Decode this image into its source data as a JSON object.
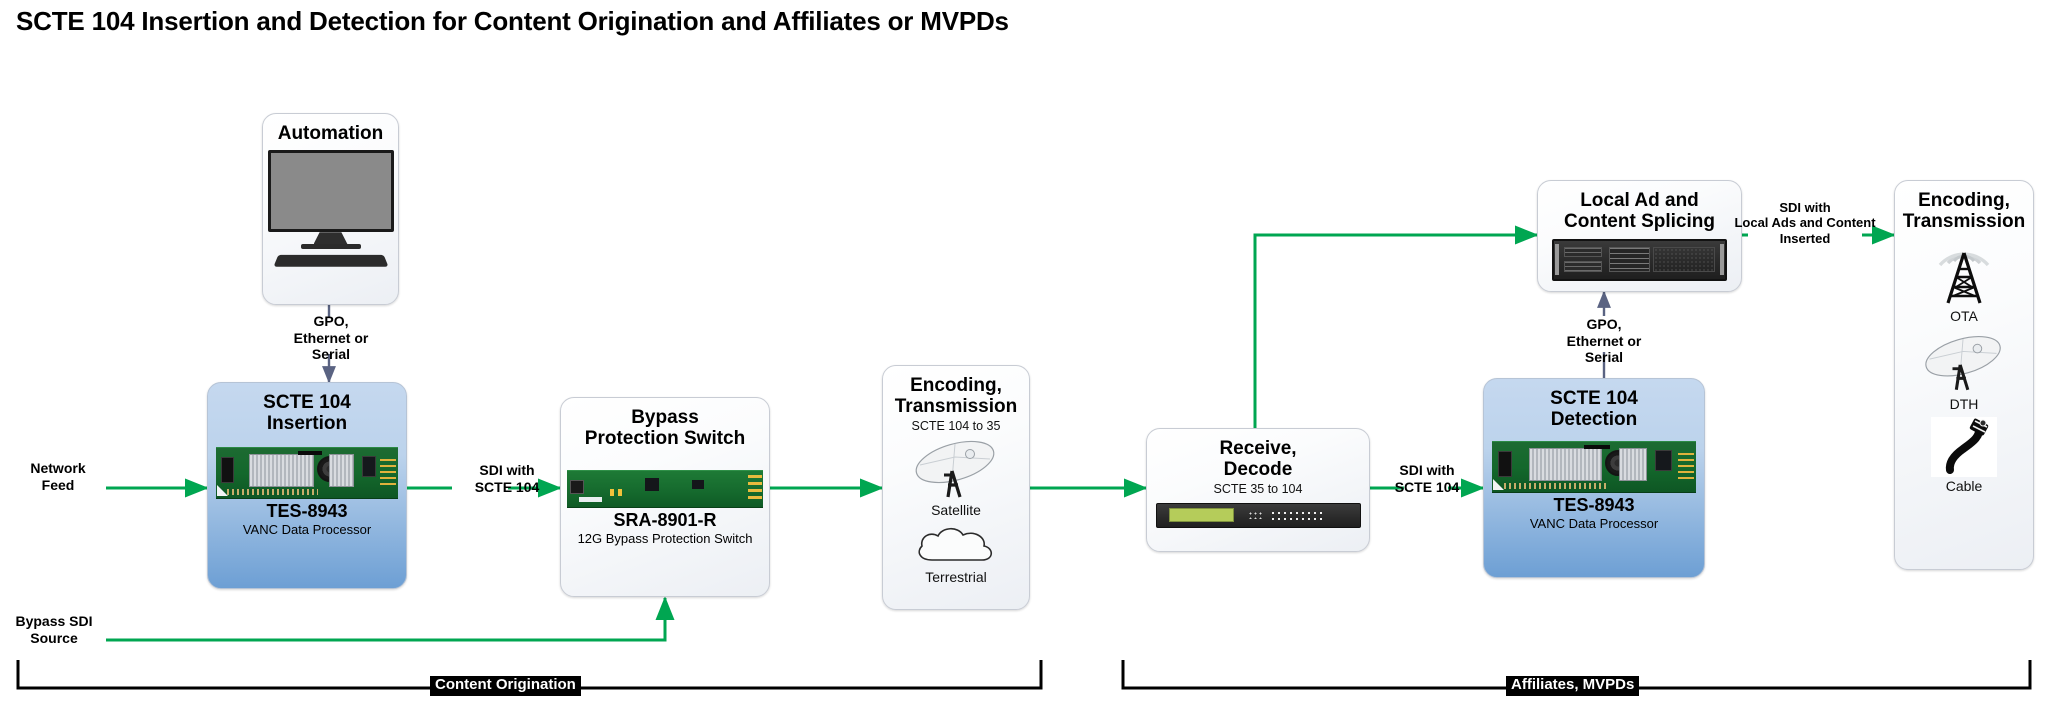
{
  "title": "SCTE 104 Insertion and Detection for Content Origination and Affiliates or MVPDs",
  "colors": {
    "flow_green": "#00a651",
    "control_arrow": "#5a6382",
    "blue_node_top": "#c5d8ef",
    "blue_node_bottom": "#6d9fd4",
    "grey_node": "#eceff4",
    "bracket_black": "#000000"
  },
  "nodes": {
    "automation": {
      "title": "Automation",
      "icon": "desktop-computer-icon"
    },
    "scte104_insertion": {
      "title": "SCTE 104\nInsertion",
      "model": "TES-8943",
      "desc": "VANC Data Processor",
      "icon": "circuit-board-icon"
    },
    "bypass_switch": {
      "title": "Bypass\nProtection Switch",
      "model": "SRA-8901-R",
      "desc": "12G Bypass Protection Switch",
      "icon": "circuit-board-icon"
    },
    "encoding_tx_left": {
      "title": "Encoding,\nTransmission",
      "sub": "SCTE 104 to 35",
      "icons": [
        {
          "name": "satellite-dish-icon",
          "caption": "Satellite"
        },
        {
          "name": "cloud-icon",
          "caption": "Terrestrial"
        }
      ]
    },
    "receive_decode": {
      "title": "Receive,\nDecode",
      "sub": "SCTE 35 to 104",
      "icon": "rack-receiver-icon"
    },
    "local_ad_splicing": {
      "title": "Local Ad and\nContent Splicing",
      "icon": "rack-server-icon"
    },
    "scte104_detection": {
      "title": "SCTE 104\nDetection",
      "model": "TES-8943",
      "desc": "VANC Data Processor",
      "icon": "circuit-board-icon"
    },
    "encoding_tx_right": {
      "title": "Encoding,\nTransmission",
      "icons": [
        {
          "name": "broadcast-tower-icon",
          "caption": "OTA"
        },
        {
          "name": "satellite-dish-icon",
          "caption": "DTH"
        },
        {
          "name": "coax-cable-icon",
          "caption": "Cable"
        }
      ]
    }
  },
  "edges": {
    "network_feed": "Network\nFeed",
    "bypass_sdi_source": "Bypass SDI\nSource",
    "gpo_left": "GPO,\nEthernet or\nSerial",
    "gpo_right": "GPO,\nEthernet or\nSerial",
    "sdi_scte104_a": "SDI with\nSCTE 104",
    "sdi_scte104_b": "SDI with\nSCTE 104",
    "sdi_local_ads": "SDI with\nLocal Ads and Content\nInserted"
  },
  "brackets": {
    "left_label": "Content Origination",
    "right_label": "Affiliates, MVPDs"
  }
}
